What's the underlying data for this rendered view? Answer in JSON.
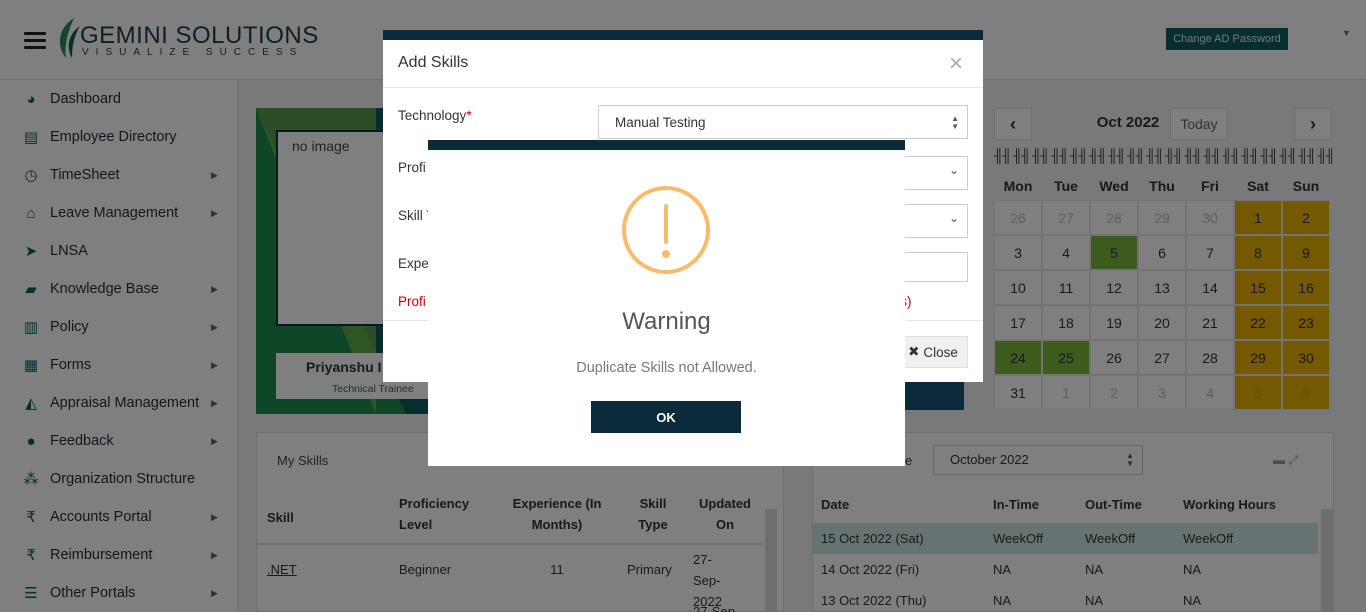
{
  "header": {
    "logo_name": "GEMINI SOLUTIONS",
    "logo_tagline": "VISUALIZE SUCCESS",
    "change_ad_password": "Change AD Password"
  },
  "sidebar": {
    "items": [
      {
        "label": "Dashboard",
        "icon": "dashboard-icon",
        "submenu": false
      },
      {
        "label": "Employee Directory",
        "icon": "directory-icon",
        "submenu": false
      },
      {
        "label": "TimeSheet",
        "icon": "clock-icon",
        "submenu": true
      },
      {
        "label": "Leave Management",
        "icon": "home-icon",
        "submenu": true
      },
      {
        "label": "LNSA",
        "icon": "send-icon",
        "submenu": false
      },
      {
        "label": "Knowledge Base",
        "icon": "folder-icon",
        "submenu": true
      },
      {
        "label": "Policy",
        "icon": "document-icon",
        "submenu": true
      },
      {
        "label": "Forms",
        "icon": "form-icon",
        "submenu": true
      },
      {
        "label": "Appraisal Management",
        "icon": "graduation-cap-icon",
        "submenu": true
      },
      {
        "label": "Feedback",
        "icon": "chat-icon",
        "submenu": true
      },
      {
        "label": "Organization Structure",
        "icon": "org-chart-icon",
        "submenu": false
      },
      {
        "label": "Accounts Portal",
        "icon": "rupee-icon",
        "submenu": true
      },
      {
        "label": "Reimbursement",
        "icon": "rupee-icon",
        "submenu": true
      },
      {
        "label": "Other Portals",
        "icon": "list-icon",
        "submenu": true
      }
    ]
  },
  "profile": {
    "image_alt": "no image",
    "name": "Priyanshu I",
    "role": "Technical Trainee"
  },
  "skills": {
    "title": "My Skills",
    "headers": [
      "Skill",
      "Proficiency Level",
      "Experience (In Months)",
      "Skill Type",
      "Updated On"
    ],
    "rows": [
      {
        "skill": ".NET",
        "level": "Beginner",
        "experience": "11",
        "type": "Primary",
        "updated": "27-Sep-2022"
      },
      {
        "skill": "",
        "level": "",
        "experience": "",
        "type": "",
        "updated": "27-Sep-"
      }
    ]
  },
  "calendar": {
    "title": "Oct 2022",
    "today_label": "Today",
    "prev": "‹",
    "next": "›",
    "rings": "╢╢ ╢╢ ╢╢ ╢╢ ╢╢ ╢╢ ╢╢ ╢╢ ╢╢ ╢╢ ╢╢ ╢╢ ╢╢ ╢╢ ╢╢ ╢╢ ╢╢ ╢╢",
    "days": [
      "Mon",
      "Tue",
      "Wed",
      "Thu",
      "Fri",
      "Sat",
      "Sun"
    ],
    "weeks": [
      [
        "26",
        "27",
        "28",
        "29",
        "30",
        "1",
        "2"
      ],
      [
        "3",
        "4",
        "5",
        "6",
        "7",
        "8",
        "9"
      ],
      [
        "10",
        "11",
        "12",
        "13",
        "14",
        "15",
        "16"
      ],
      [
        "17",
        "18",
        "19",
        "20",
        "21",
        "22",
        "23"
      ],
      [
        "24",
        "25",
        "26",
        "27",
        "28",
        "29",
        "30"
      ],
      [
        "31",
        "1",
        "2",
        "3",
        "4",
        "5",
        "6"
      ]
    ],
    "colors": {
      "weekend": "#e8b200",
      "present": "#7ab63a"
    }
  },
  "attendance": {
    "label_fragment": "e",
    "month": "October 2022",
    "headers": [
      "Date",
      "In-Time",
      "Out-Time",
      "Working Hours"
    ],
    "rows": [
      {
        "date": "15 Oct 2022 (Sat)",
        "in": "WeekOff",
        "out": "WeekOff",
        "hours": "WeekOff"
      },
      {
        "date": "14 Oct 2022 (Fri)",
        "in": "NA",
        "out": "NA",
        "hours": "NA"
      },
      {
        "date": "13 Oct 2022 (Thu)",
        "in": "NA",
        "out": "NA",
        "hours": "NA"
      }
    ]
  },
  "add_skills_modal": {
    "title": "Add Skills",
    "close_x": "×",
    "technology_label": "Technology",
    "required_mark": "*",
    "technology_value": "Manual Testing",
    "proficiency_label": "Profi",
    "skill_type_label": "Skill T",
    "experience_label": "Exper",
    "error_left": "Profi",
    "error_right": "ths)",
    "close_button": "Close"
  },
  "warning_dialog": {
    "title": "Warning",
    "message": "Duplicate Skills not Allowed.",
    "ok": "OK",
    "accent": "#f8bb6b"
  }
}
